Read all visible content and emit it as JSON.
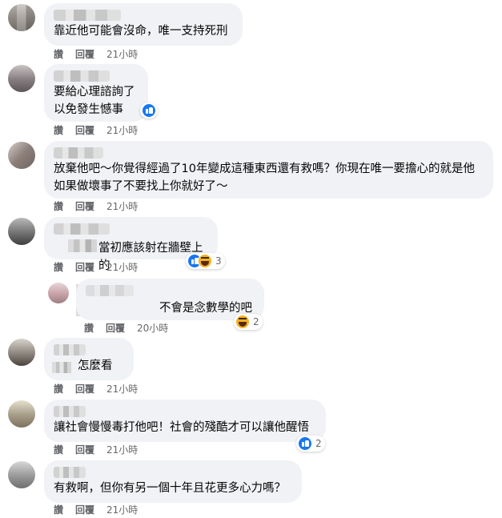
{
  "actions": {
    "like": "讚",
    "reply": "回覆"
  },
  "comments": [
    {
      "text": "靠近他可能會沒命，唯一支持死刑",
      "time": "21小時"
    },
    {
      "text": "要給心理諮詢了\n以免發生憾事",
      "time": "21小時",
      "reactions": {
        "icons": [
          "like-icon"
        ]
      }
    },
    {
      "text": "放棄他吧～你覺得經過了10年變成這種東西還有救嗎？你現在唯一要擔心的就是他如果做壞事了不要找上你就好了～",
      "time": "21小時"
    },
    {
      "text": "當初應該射在牆壁上的",
      "time": "21小時",
      "reactions": {
        "icons": [
          "like-icon",
          "haha-icon"
        ],
        "count": "3"
      }
    },
    {
      "text": "不會是念數學的吧",
      "time": "20小時",
      "reactions": {
        "icons": [
          "haha-icon"
        ],
        "count": "2"
      }
    },
    {
      "text": "怎麼看",
      "time": "21小時"
    },
    {
      "text": "讓社會慢慢毒打他吧！社會的殘酷才可以讓他醒悟",
      "time": "21小時",
      "reactions": {
        "icons": [
          "like-icon"
        ],
        "count": "2"
      }
    },
    {
      "text": "有救啊，但你有另一個十年且花更多心力嗎？",
      "time": "21小時"
    }
  ]
}
